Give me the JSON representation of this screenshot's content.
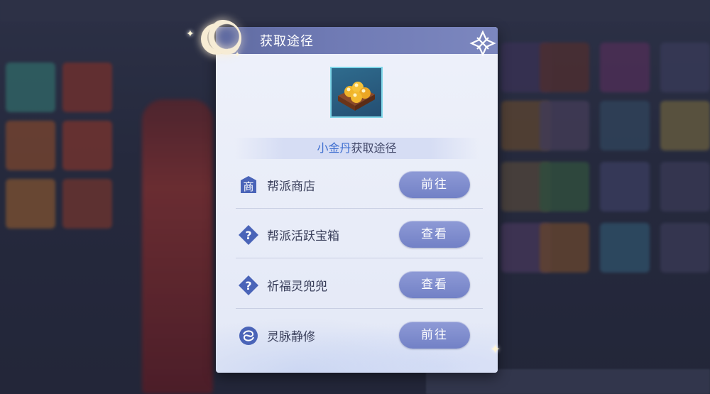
{
  "dialog": {
    "title": "获取途径",
    "item_name": "小金丹",
    "subtitle_suffix": "获取途径",
    "rows": [
      {
        "label": "帮派商店",
        "button": "前往",
        "icon": "shop-icon"
      },
      {
        "label": "帮派活跃宝箱",
        "button": "查看",
        "icon": "question-icon"
      },
      {
        "label": "祈福灵兜兜",
        "button": "查看",
        "icon": "question-icon"
      },
      {
        "label": "灵脉静修",
        "button": "前往",
        "icon": "swirl-icon"
      }
    ]
  },
  "colors": {
    "header": "#6f7ab4",
    "button": "#7f8cce",
    "highlight_text": "#3f6fd0",
    "item_border": "#7fd6e8"
  }
}
